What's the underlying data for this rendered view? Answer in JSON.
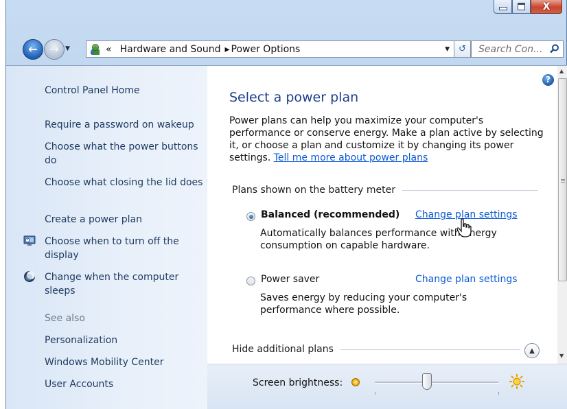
{
  "window": {
    "caption_buttons": {
      "minimize": "minimize",
      "maximize": "maximize",
      "close": "X"
    }
  },
  "nav": {
    "breadcrumb": {
      "overflow": "«",
      "items": [
        "Hardware and Sound",
        "Power Options"
      ]
    },
    "search_placeholder": "Search Con..."
  },
  "sidebar": {
    "home": "Control Panel Home",
    "tasks": [
      "Require a password on wakeup",
      "Choose what the power buttons do",
      "Choose what closing the lid does",
      "Create a power plan",
      "Choose when to turn off the display",
      "Change when the computer sleeps"
    ],
    "see_also_heading": "See also",
    "see_also": [
      "Personalization",
      "Windows Mobility Center",
      "User Accounts"
    ]
  },
  "main": {
    "help": "?",
    "title": "Select a power plan",
    "description": "Power plans can help you maximize your computer's performance or conserve energy. Make a plan active by selecting it, or choose a plan and customize it by changing its power settings.",
    "tell_me_more": "Tell me more about power plans",
    "battery_section": "Plans shown on the battery meter",
    "plans": [
      {
        "name": "Balanced (recommended)",
        "selected": true,
        "change_link": "Change plan settings",
        "description": "Automatically balances performance with energy consumption on capable hardware."
      },
      {
        "name": "Power saver",
        "selected": false,
        "change_link": "Change plan settings",
        "description": "Saves energy by reducing your computer's performance where possible."
      }
    ],
    "additional_section": "Hide additional plans"
  },
  "brightness": {
    "label": "Screen brightness:",
    "level_fraction": 0.42
  },
  "colors": {
    "link": "#0a5bd4",
    "title": "#1e3f8a",
    "sidebar_text": "#1e3a5f",
    "close_button": "#c8452f"
  }
}
